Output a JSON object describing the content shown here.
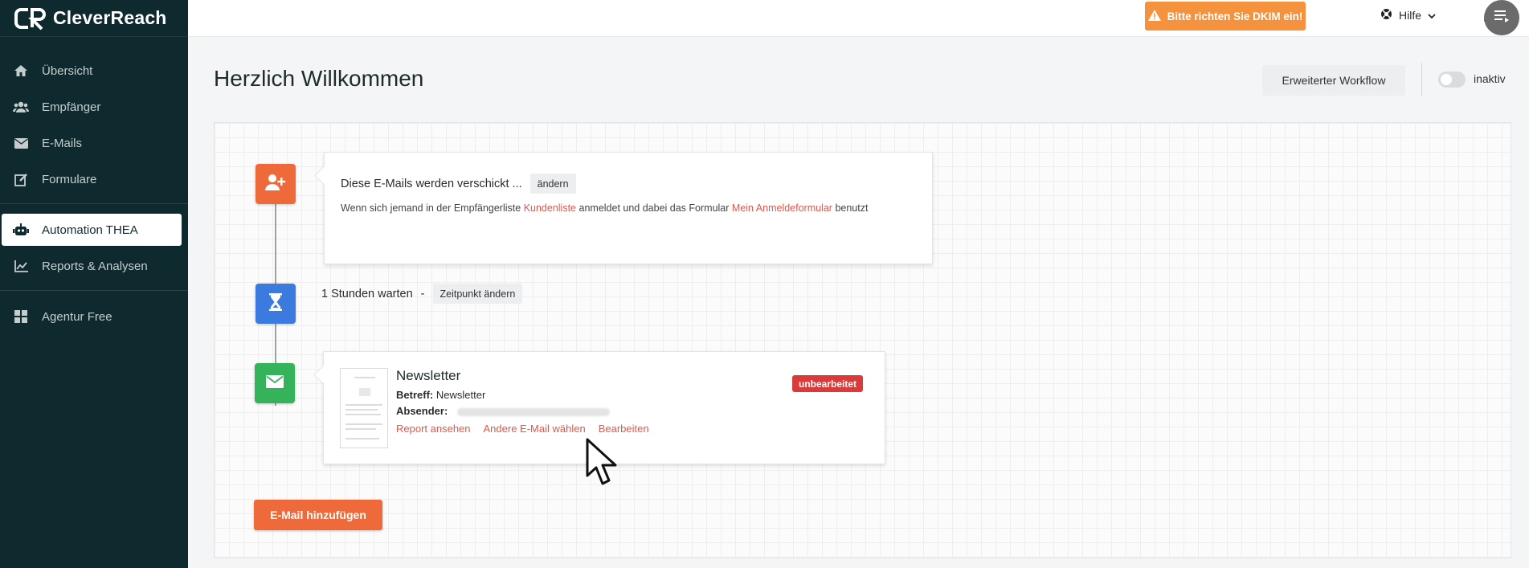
{
  "brand": {
    "name": "CleverReach"
  },
  "sidebar": {
    "items": [
      {
        "label": "Übersicht",
        "icon": "home-icon"
      },
      {
        "label": "Empfänger",
        "icon": "users-icon"
      },
      {
        "label": "E-Mails",
        "icon": "envelope-icon"
      },
      {
        "label": "Formulare",
        "icon": "form-edit-icon"
      },
      {
        "label": "Automation THEA",
        "icon": "robot-icon",
        "active": true
      },
      {
        "label": "Reports & Analysen",
        "icon": "chart-icon"
      },
      {
        "label": "Agentur Free",
        "icon": "grid-icon"
      }
    ]
  },
  "topbar": {
    "dkim_warning": "Bitte richten Sie DKIM ein!",
    "help_label": "Hilfe"
  },
  "page": {
    "title": "Herzlich Willkommen",
    "workflow_button": "Erweiterter Workflow",
    "toggle_label": "inaktiv"
  },
  "workflow": {
    "trigger": {
      "title": "Diese E-Mails werden verschickt ...",
      "change_button": "ändern",
      "desc_before": "Wenn sich jemand in der Empfängerliste",
      "list_link": "Kundenliste",
      "desc_middle": "anmeldet und dabei das Formular",
      "form_link": "Mein Anmeldeformular",
      "desc_after": "benutzt"
    },
    "wait": {
      "text": "1 Stunden warten",
      "separator": "-",
      "change_button": "Zeitpunkt ändern"
    },
    "email": {
      "title": "Newsletter",
      "subject_label": "Betreff:",
      "subject_value": "Newsletter",
      "sender_label": "Absender:",
      "status_badge": "unbearbeitet",
      "links": [
        "Report ansehen",
        "Andere E-Mail wählen",
        "Bearbeiten"
      ]
    },
    "add_email_button": "E-Mail hinzufügen"
  },
  "colors": {
    "sidebar_bg": "#0f2a2e",
    "accent_orange": "#ef6a3a",
    "warning_orange": "#f4923d",
    "step_blue": "#3b7be0",
    "step_green": "#34b35a",
    "badge_red": "#d93a3a",
    "link_red": "#e0574b"
  }
}
